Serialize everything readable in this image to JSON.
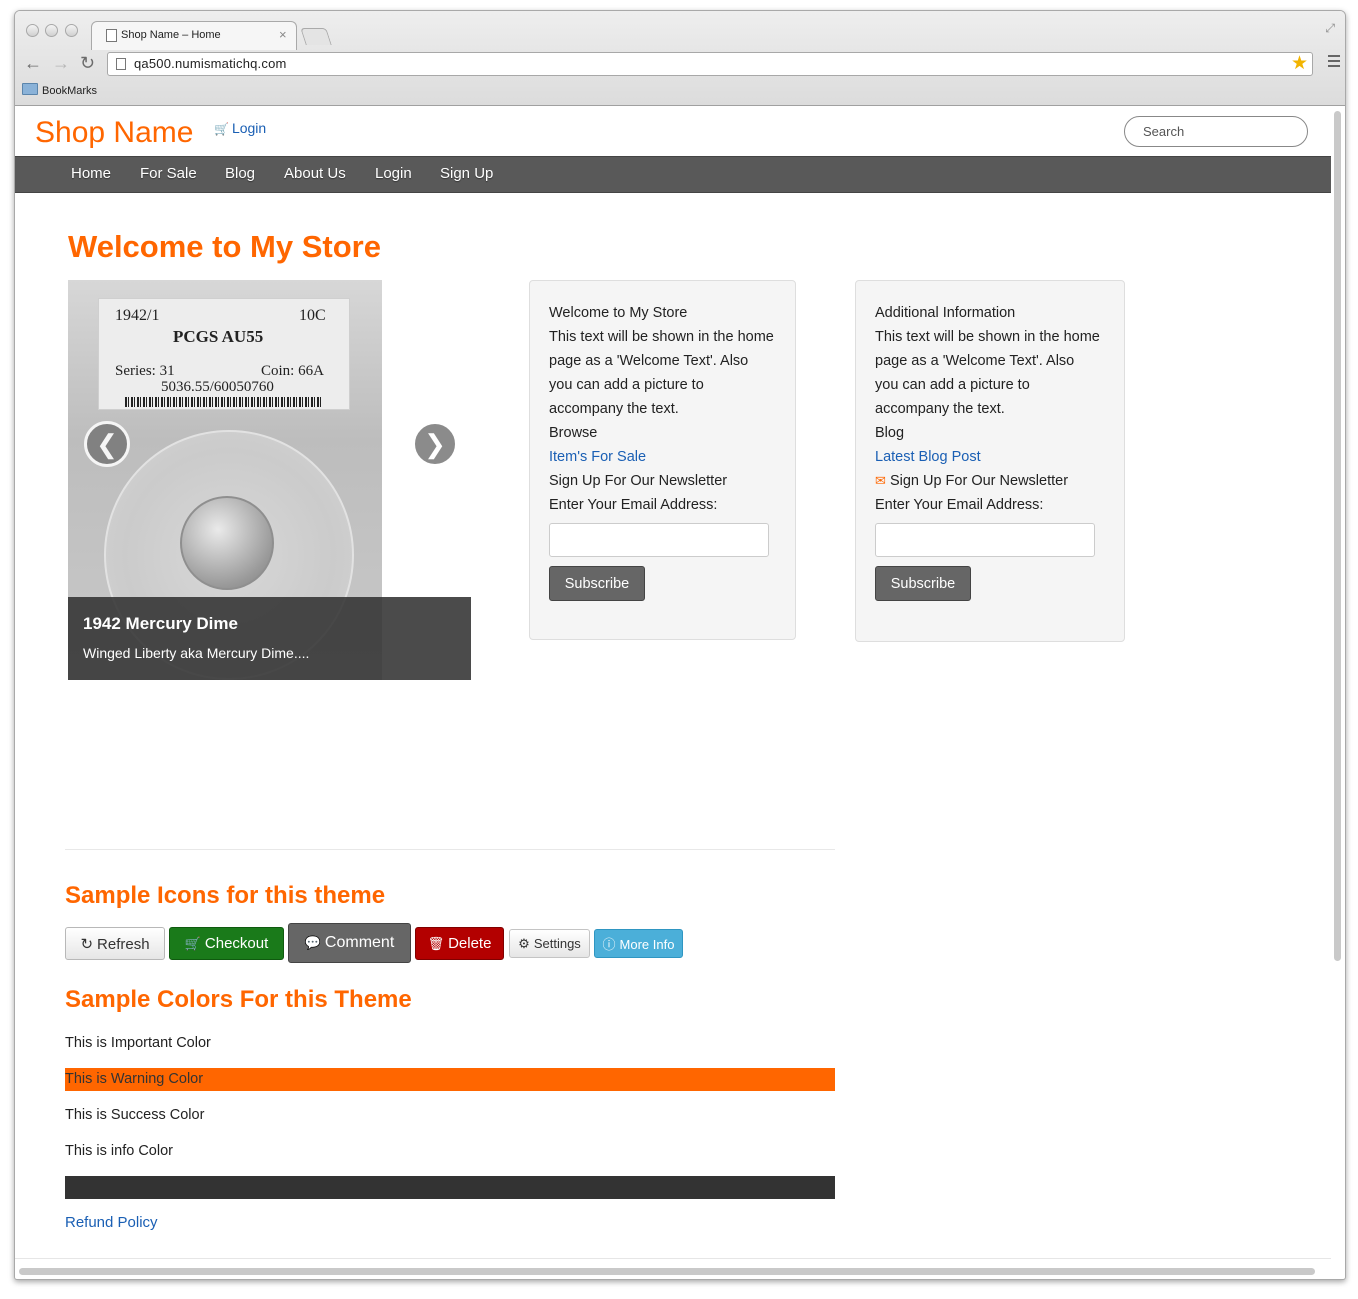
{
  "browser": {
    "tab_title": "Shop Name – Home",
    "tab_close": "×",
    "url": "qa500.numismatichq.com",
    "bookmark_folder": "BookMarks",
    "back_glyph": "←",
    "forward_glyph": "→",
    "reload_glyph": "↻",
    "star_glyph": "★",
    "resize_glyph": "⤢"
  },
  "header": {
    "shop_name": "Shop Name",
    "cart_glyph": "🛒",
    "login_label": "Login",
    "search_placeholder": "Search"
  },
  "nav": {
    "items": [
      "Home",
      "For Sale",
      "Blog",
      "About Us",
      "Login",
      "Sign Up"
    ]
  },
  "main": {
    "title": "Welcome to My Store",
    "carousel": {
      "slab": {
        "year": "1942/1",
        "denom": "10C",
        "grade": "PCGS AU55",
        "series": "Series: 31",
        "coin": "Coin: 66A",
        "cert": "5036.55/60050760"
      },
      "prev_glyph": "❮",
      "next_glyph": "❯",
      "caption_title": "1942 Mercury Dime",
      "caption_text": "Winged Liberty aka Mercury Dime...."
    },
    "welcome_box": {
      "lines": [
        "Welcome to My Store",
        "This text will be shown in the home",
        "page as a 'Welcome Text'. Also",
        "you can add a picture to",
        "accompany the text.",
        "Browse"
      ],
      "link": "Item's For Sale",
      "newsletter": "Sign Up For Our Newsletter",
      "email_label": "Enter Your Email Address:",
      "subscribe": "Subscribe"
    },
    "info_box": {
      "lines": [
        "Additional Information",
        "This text will be shown in the home",
        "page as a 'Welcome Text'. Also",
        "you can add a picture to",
        "accompany the text.",
        "Blog"
      ],
      "link": "Latest Blog Post",
      "mail_glyph": "✉",
      "newsletter": "Sign Up For Our Newsletter",
      "email_label": "Enter Your Email Address:",
      "subscribe": "Subscribe"
    },
    "icons_heading": "Sample Icons for this theme",
    "buttons": {
      "refresh": {
        "label": "Refresh",
        "glyph": "↻"
      },
      "checkout": {
        "label": "Checkout",
        "glyph": "🛒",
        "color": "#1a7a1a"
      },
      "comment": {
        "label": "Comment",
        "glyph": "💬",
        "color": "#666666"
      },
      "delete": {
        "label": "Delete",
        "glyph": "🗑",
        "color": "#b30000"
      },
      "settings": {
        "label": "Settings",
        "glyph": "⚙"
      },
      "more_info": {
        "label": "More Info",
        "glyph": "ⓘ",
        "color": "#4bafd9"
      }
    },
    "colors_heading": "Sample Colors For this Theme",
    "color_rows": {
      "important": "This is Important Color",
      "warning": "This is Warning Color",
      "success": "This is Success Color",
      "info": "This is info Color"
    },
    "colors": {
      "accent": "#ff6600",
      "warning_bg": "#ff6600",
      "dark_bar": "#333333",
      "link": "#1a5fb4"
    },
    "refund_link": "Refund Policy"
  }
}
